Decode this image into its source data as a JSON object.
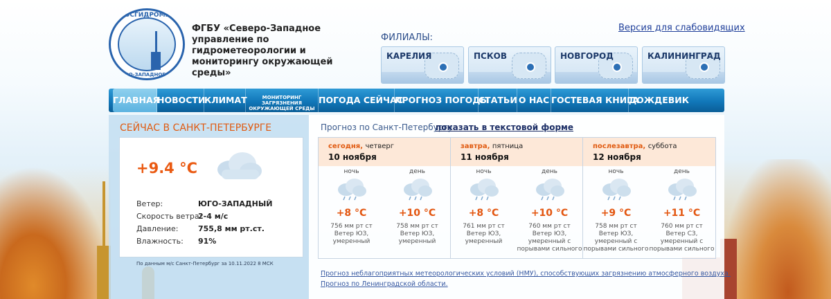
{
  "header": {
    "logo_top": "РОСГИДРОМЕТ",
    "logo_bottom": "СЕВЕРО-ЗАПАДНОЕ УГМС",
    "org_title": "ФГБУ «Северо-Западное управление по гидрометеорологии и мониторингу окружающей среды»",
    "accessible_link": "Версия для слабовидящих",
    "branches_label": "ФИЛИАЛЫ:",
    "branches": [
      "КАРЕЛИЯ",
      "ПСКОВ",
      "НОВГОРОД",
      "КАЛИНИНГРАД"
    ]
  },
  "nav": {
    "items": [
      "ГЛАВНАЯ",
      "НОВОСТИ",
      "КЛИМАТ",
      "МОНИТОРИНГ ЗАГРЯЗНЕНИЯ ОКРУЖАЮЩЕЙ СРЕДЫ",
      "ПОГОДА СЕЙЧАС",
      "ПРОГНОЗ ПОГОДЫ",
      "СТАТЬИ",
      "О НАС",
      "ГОСТЕВАЯ КНИГА",
      "ДОЖДЕВИК"
    ],
    "active": "ГЛАВНАЯ"
  },
  "now": {
    "title": "СЕЙЧАС В САНКТ-ПЕТЕРБУРГЕ",
    "temp": "+9.4 °C",
    "icon": "cloud-icon",
    "rows": [
      {
        "label": "Ветер:",
        "value": "ЮГО-ЗАПАДНЫЙ"
      },
      {
        "label": "Скорость ветра:",
        "value": "2-4 м/с"
      },
      {
        "label": "Давление:",
        "value": "755,8 мм рт.ст."
      },
      {
        "label": "Влажность:",
        "value": "91%"
      }
    ],
    "source": "По данным м/с Санкт-Петербург за 10.11.2022 8 МСК"
  },
  "forecast": {
    "intro": "Прогноз по Санкт-Петербургу",
    "text_link": "показать в текстовой форме",
    "days": [
      {
        "name": "сегодня,",
        "weekday": "четверг",
        "date": "10 ноября",
        "parts": [
          {
            "label": "ночь",
            "temp": "+8 °C",
            "pressure": "756 мм рт ст",
            "wind": "Ветер ЮЗ,",
            "strength": "умеренный",
            "extra": ""
          },
          {
            "label": "день",
            "temp": "+10 °C",
            "pressure": "758 мм рт ст",
            "wind": "Ветер ЮЗ,",
            "strength": "умеренный",
            "extra": ""
          }
        ]
      },
      {
        "name": "завтра,",
        "weekday": "пятница",
        "date": "11 ноября",
        "parts": [
          {
            "label": "ночь",
            "temp": "+8 °C",
            "pressure": "761 мм рт ст",
            "wind": "Ветер ЮЗ,",
            "strength": "умеренный",
            "extra": ""
          },
          {
            "label": "день",
            "temp": "+10 °C",
            "pressure": "760 мм рт ст",
            "wind": "Ветер ЮЗ,",
            "strength": "умеренный с",
            "extra": "порывами сильного"
          }
        ]
      },
      {
        "name": "послезавтра,",
        "weekday": "суббота",
        "date": "12 ноября",
        "parts": [
          {
            "label": "ночь",
            "temp": "+9 °C",
            "pressure": "758 мм рт ст",
            "wind": "Ветер ЮЗ,",
            "strength": "умеренный с",
            "extra": "порывами сильного"
          },
          {
            "label": "день",
            "temp": "+11 °C",
            "pressure": "760 мм рт ст",
            "wind": "Ветер СЗ,",
            "strength": "умеренный с",
            "extra": "порывами сильного"
          }
        ]
      }
    ],
    "links": [
      "Прогноз неблагоприятных метеорологических условий (НМУ), способствующих загрязнению атмосферного воздуха.",
      "Прогноз по Ленинградской области."
    ]
  }
}
